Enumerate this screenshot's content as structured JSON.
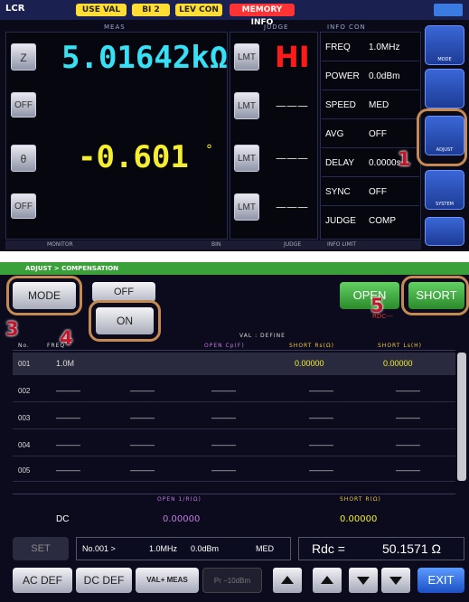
{
  "top_screen": {
    "title": "LCR",
    "chips": [
      "USE VAL",
      "BI 2",
      "LEV CON",
      "MEMORY INFO"
    ],
    "meas_header": "MEAS",
    "judge_header": "JUDGE",
    "cond_header": "INFO CON",
    "param1_label": "Z",
    "param1_value": "5.01642kΩ",
    "param1_judge_btn": "LMT",
    "param1_judge": "HI",
    "param2_label": "OFF",
    "param2_judge_btn": "LMT",
    "param2_judge": "———",
    "param3_label": "θ",
    "param3_value": "-0.601",
    "param3_unit": "°",
    "param3_judge_btn": "LMT",
    "param3_judge": "———",
    "param4_label": "OFF",
    "param4_judge_btn": "LMT",
    "param4_judge": "———",
    "conditions": [
      {
        "key": "FREQ",
        "val": "1.0MHz"
      },
      {
        "key": "POWER",
        "val": "0.0dBm"
      },
      {
        "key": "SPEED",
        "val": "MED"
      },
      {
        "key": "AVG",
        "val": "OFF"
      },
      {
        "key": "DELAY",
        "val": "0.0000s"
      },
      {
        "key": "SYNC",
        "val": "OFF"
      },
      {
        "key": "JUDGE",
        "val": "COMP"
      }
    ],
    "footer_monitor": "MONITOR",
    "footer_bin": "BIN",
    "footer_judge": "JUDGE",
    "footer_info": "INFO LIMIT",
    "side_icons": [
      "MODE",
      "",
      "ADJUST",
      "SYSTEM",
      ""
    ],
    "callout_1": "1"
  },
  "bottom_screen": {
    "title_bar": "ADJUST > COMPENSATION",
    "mode_btn": "MODE",
    "off_btn": "OFF",
    "on_btn": "ON",
    "open_btn": "OPEN",
    "short_btn": "SHORT",
    "rdc_small": "RDC---",
    "val_define": "VAL : DEFINE",
    "col_no": "No.",
    "col_freq": "FREQ",
    "col_open_g": "OPEN Cp(F)",
    "col_short_rs": "SHORT Rs(Ω)",
    "col_short_ls": "SHORT Ls(H)",
    "rows": [
      {
        "no": "001",
        "freq": "1.0M",
        "og": "",
        "ob": "",
        "rs": "0.00000",
        "ls": "0.00000"
      },
      {
        "no": "002",
        "freq": "———",
        "og": "———",
        "ob": "———",
        "rs": "———",
        "ls": "———"
      },
      {
        "no": "003",
        "freq": "———",
        "og": "———",
        "ob": "———",
        "rs": "———",
        "ls": "———"
      },
      {
        "no": "004",
        "freq": "———",
        "og": "———",
        "ob": "———",
        "rs": "———",
        "ls": "———"
      },
      {
        "no": "005",
        "freq": "———",
        "og": "———",
        "ob": "———",
        "rs": "———",
        "ls": "———"
      }
    ],
    "dc_open_header": "OPEN 1/R(Ω)",
    "dc_short_header": "SHORT R(Ω)",
    "dc_label": "DC",
    "dc_open_val": "0.00000",
    "dc_short_val": "0.00000",
    "set_btn": "SET",
    "status_no": "No.001 >",
    "status_freq": "1.0MHz",
    "status_power": "0.0dBm",
    "status_speed": "MED",
    "rdc_label": "Rdc  =",
    "rdc_value": "50.1571 Ω",
    "ac_def_btn": "AC DEF",
    "dc_def_btn": "DC DEF",
    "val_meas_btn": "VAL+ MEAS",
    "pwr_box": "Pr −10dBm",
    "exit_btn": "EXIT",
    "callout_3": "3",
    "callout_4": "4",
    "callout_5": "5"
  },
  "colors": {
    "accent_cyan": "#36e0f5",
    "judge_red": "#ff1a1a",
    "value_yellow": "#f4ee2e",
    "green": "#3fbf3f",
    "callout": "#c0152a",
    "ring": "#c48a52"
  }
}
